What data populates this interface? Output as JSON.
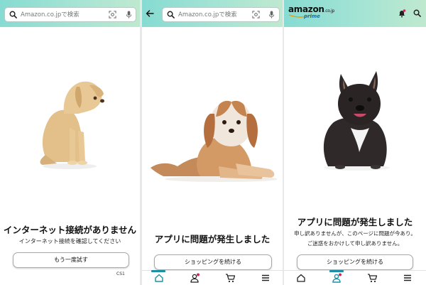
{
  "panel1": {
    "search_placeholder": "Amazon.co.jpで検索",
    "title": "インターネット接続がありません",
    "subtitle": "インターネット接続を確認してください",
    "retry_label": "もう一度試す",
    "error_code": "CS1"
  },
  "panel2": {
    "search_placeholder": "Amazon.co.jpで検索",
    "title": "アプリに問題が発生しました",
    "continue_label": "ショッピングを続ける"
  },
  "panel3": {
    "logo_text": "amazon",
    "logo_suffix": ".co.jp",
    "logo_prime": "prime",
    "title": "アプリに問題が発生しました",
    "subtitle_line1": "申し訳ありませんが、このページに問題が今あり。",
    "subtitle_line2": "ご迷惑をおかけして申し訳ありません。",
    "continue_label": "ショッピングを続ける"
  },
  "nav_icons": [
    "home-icon",
    "account-icon",
    "cart-icon",
    "menu-icon"
  ],
  "colors": {
    "header_start": "#86dbd2",
    "header_end": "#bfe9cf",
    "accent": "#1f8fa6",
    "badge": "#d6235a"
  }
}
